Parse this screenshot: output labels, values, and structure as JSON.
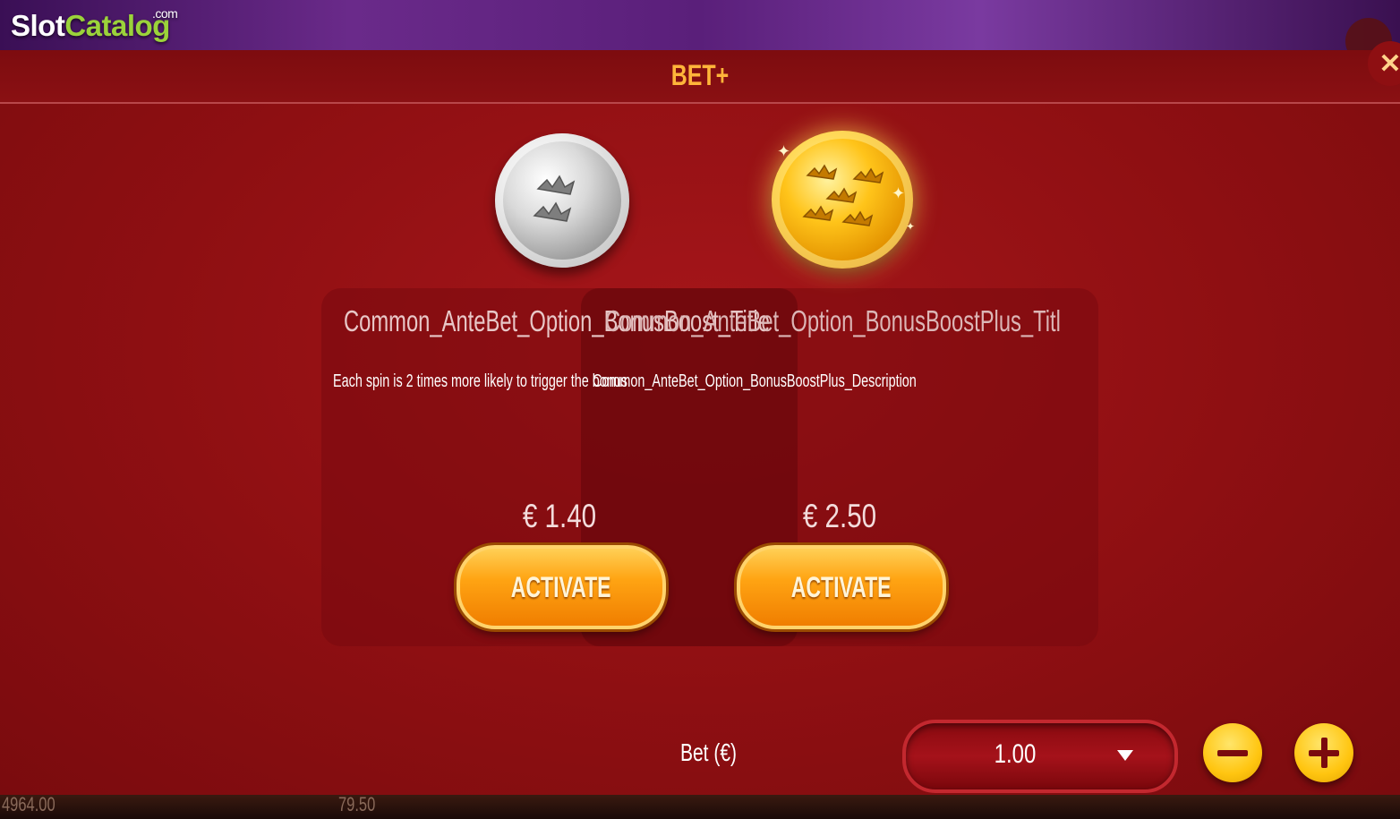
{
  "logo": {
    "slot": "Slot",
    "catalog": "Catalog",
    "com": ".com"
  },
  "header": {
    "title": "BET+"
  },
  "options": [
    {
      "title": "Common_AnteBet_Option_BonusBoost_Title",
      "description": "Each spin is 2 times more likely to trigger the bonus",
      "price": "€ 1.40",
      "activate_label": "ACTIVATE",
      "coin": "silver-coin-icon"
    },
    {
      "title": "Common_AnteBet_Option_BonusBoostPlus_Titl",
      "description": "Common_AnteBet_Option_BonusBoostPlus_Description",
      "price": "€ 2.50",
      "activate_label": "ACTIVATE",
      "coin": "gold-coin-icon"
    }
  ],
  "bet": {
    "label": "Bet (€)",
    "value": "1.00"
  },
  "footer": {
    "balance": "4964.00",
    "bet": "79.50"
  },
  "colors": {
    "accent": "#ffb53a",
    "panel": "#8e0f12",
    "button": "#ffa413"
  }
}
